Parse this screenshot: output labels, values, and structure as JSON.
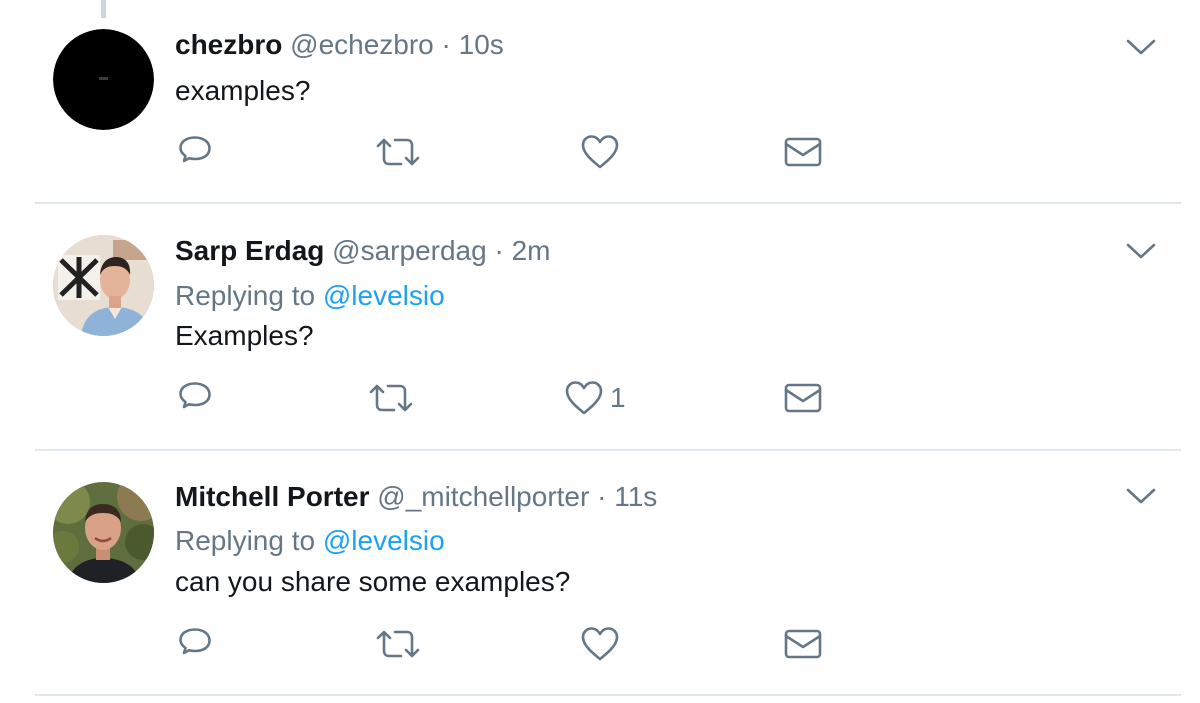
{
  "tweets": [
    {
      "name": "chezbro",
      "handle": "@echezbro",
      "separator": "·",
      "time": "10s",
      "replying_prefix": "",
      "replying_to": "",
      "text": "examples?",
      "likes": "",
      "avatar": "black-circle"
    },
    {
      "name": "Sarp Erdag",
      "handle": "@sarperdag",
      "separator": "·",
      "time": "2m",
      "replying_prefix": "Replying to",
      "replying_to": "@levelsio",
      "text": "Examples?",
      "likes": "1",
      "avatar": "photo-man-shirt"
    },
    {
      "name": "Mitchell Porter",
      "handle": "@_mitchellporter",
      "separator": "·",
      "time": "11s",
      "replying_prefix": "Replying to",
      "replying_to": "@levelsio",
      "text": "can you share some examples?",
      "likes": "",
      "avatar": "photo-man-trees"
    }
  ],
  "icons": {
    "reply": "reply-icon",
    "retweet": "retweet-icon",
    "like": "like-icon",
    "dm": "envelope-icon",
    "menu": "chevron-down-icon"
  },
  "colors": {
    "text": "#14171a",
    "secondary": "#657786",
    "link": "#1da1f2",
    "divider": "#e1e8ed"
  }
}
